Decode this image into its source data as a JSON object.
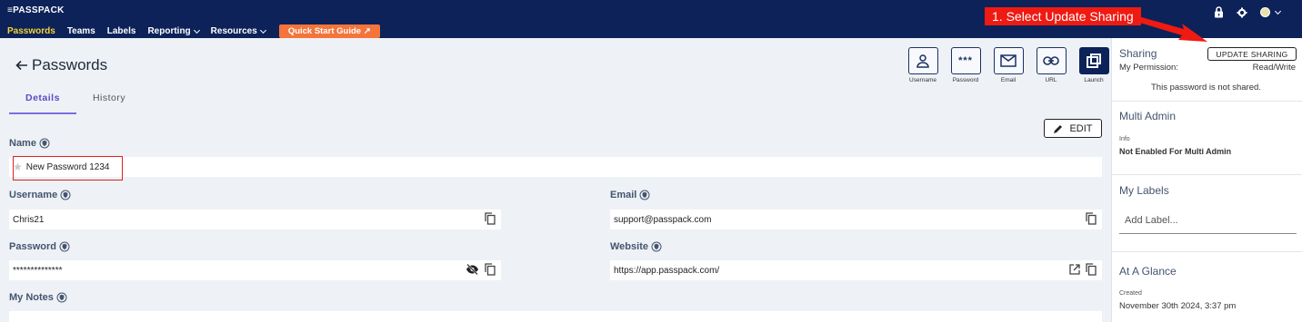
{
  "app": {
    "logo": "≡PASSPACK"
  },
  "nav": {
    "items": [
      {
        "label": "Passwords"
      },
      {
        "label": "Teams"
      },
      {
        "label": "Labels"
      },
      {
        "label": "Reporting"
      },
      {
        "label": "Resources"
      }
    ],
    "quick_start": "Quick Start Guide ↗"
  },
  "annotation": "1. Select Update Sharing",
  "page": {
    "title": "Passwords",
    "tabs": [
      {
        "label": "Details"
      },
      {
        "label": "History"
      }
    ],
    "edit_label": "EDIT"
  },
  "tools": [
    {
      "label": "Username",
      "icon": "person-icon"
    },
    {
      "label": "Password",
      "icon": "password-dots-icon",
      "glyph": "***"
    },
    {
      "label": "Email",
      "icon": "envelope-icon"
    },
    {
      "label": "URL",
      "icon": "link-icon"
    },
    {
      "label": "Launch",
      "icon": "launch-icon"
    }
  ],
  "fields": {
    "name": {
      "label": "Name",
      "value": "New Password 1234"
    },
    "username": {
      "label": "Username",
      "value": "Chris21"
    },
    "email": {
      "label": "Email",
      "value": "support@passpack.com"
    },
    "password": {
      "label": "Password",
      "value": "**************"
    },
    "website": {
      "label": "Website",
      "value": "https://app.passpack.com/"
    },
    "notes": {
      "label": "My Notes"
    }
  },
  "sidebar": {
    "sharing": {
      "title": "Sharing",
      "button": "UPDATE SHARING",
      "permission_label": "My Permission:",
      "permission_value": "Read/Write",
      "status": "This password is not shared."
    },
    "multi_admin": {
      "title": "Multi Admin",
      "info_label": "Info",
      "info_value": "Not Enabled For Multi Admin"
    },
    "labels": {
      "title": "My Labels",
      "placeholder": "Add Label..."
    },
    "glance": {
      "title": "At A Glance",
      "created_label": "Created",
      "created_value": "November 30th 2024, 3:37 pm"
    }
  },
  "colors": {
    "nav_bg": "#0c2259",
    "accent": "#f6d334",
    "quick_start": "#f4743b",
    "annotation": "#ef1a12"
  }
}
